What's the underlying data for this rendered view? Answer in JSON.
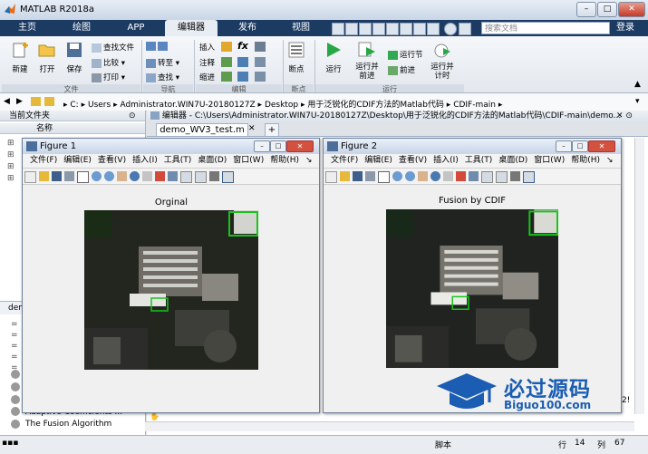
{
  "app": {
    "title": "MATLAB R2018a"
  },
  "tabs": [
    "主页",
    "绘图",
    "APP",
    "编辑器",
    "发布",
    "视图"
  ],
  "search": {
    "placeholder": "搜索文档"
  },
  "login": "登录",
  "ribbon": {
    "new": "新建",
    "open": "打开",
    "save": "保存",
    "find_files": "查找文件",
    "compare": "比较",
    "print": "打印",
    "goto": "转至",
    "find": "查找",
    "insert": "插入",
    "comment": "注释",
    "indent": "缩进",
    "fx": "fx",
    "breakpoints": "断点",
    "run": "运行",
    "run_advance": "运行并\n前进",
    "run_section": "运行节",
    "advance": "前进",
    "run_time": "运行并\n计时",
    "groups": {
      "file": "文件",
      "navigate": "导航",
      "edit": "编辑",
      "breakpoints": "断点",
      "run": "运行"
    }
  },
  "path": [
    "C:",
    "Users",
    "Administrator.WIN7U-20180127Z",
    "Desktop",
    "用于泛锐化的CDIF方法的Matlab代码",
    "CDIF-main"
  ],
  "left_panel": {
    "title": "当前文件夹",
    "column": "名称",
    "lower_prefix": "dem",
    "items": [
      "Adaptive Coefficients ...",
      "The Fusion Algorithm"
    ]
  },
  "editor": {
    "title": "编辑器 - C:\\Users\\Administrator.WIN7U-20180127Z\\Desktop\\用于泛锐化的CDIF方法的Matlab代码\\CDIF-main\\demo...",
    "tab": "demo_WV3_test.m"
  },
  "status": {
    "mode": "脚本",
    "row_label": "行",
    "row": "14",
    "col_label": "列",
    "col": "67"
  },
  "figures": [
    {
      "title": "Figure 1",
      "axes_title": "Orginal"
    },
    {
      "title": "Figure 2",
      "axes_title": "Fusion by CDIF"
    }
  ],
  "figure_menu": [
    "文件(F)",
    "编辑(E)",
    "查看(V)",
    "插入(I)",
    "工具(T)",
    "桌面(D)",
    "窗口(W)",
    "帮助(H)"
  ],
  "watermark": {
    "text": "必过源码",
    "url": "Biguo100.com"
  },
  "colors": {
    "tabbar": "#1b3b63",
    "accent_green": "#18c41c",
    "watermark_blue": "#1a5db2"
  }
}
